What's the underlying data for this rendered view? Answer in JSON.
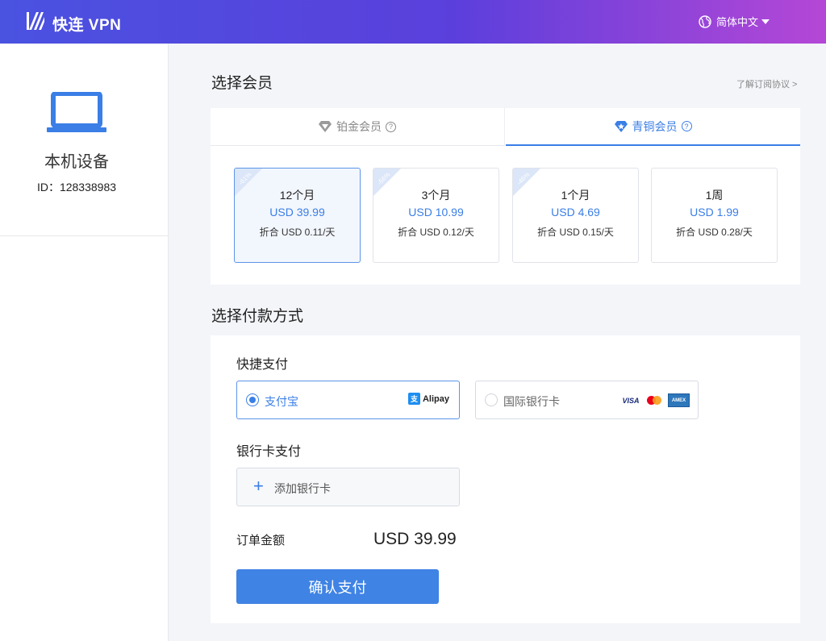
{
  "header": {
    "app_title": "快连 VPN",
    "language": "简体中文",
    "logo_icon": "brand-logo-icon",
    "globe_icon": "globe-icon"
  },
  "sidebar": {
    "device_icon": "laptop-icon",
    "device_title": "本机设备",
    "device_id": "ID：128338983"
  },
  "membership": {
    "section_title": "选择会员",
    "agreement_link": "了解订阅协议 >",
    "tabs": [
      {
        "label": "铂金会员",
        "icon": "diamond-icon",
        "active": false
      },
      {
        "label": "青铜会员",
        "icon": "diamond-star-icon",
        "active": true
      }
    ],
    "plans": [
      {
        "discount": "-61%",
        "duration": "12个月",
        "price": "USD 39.99",
        "per_day": "折合 USD 0.11/天",
        "selected": true
      },
      {
        "discount": "-56%",
        "duration": "3个月",
        "price": "USD 10.99",
        "per_day": "折合 USD 0.12/天",
        "selected": false
      },
      {
        "discount": "-46%",
        "duration": "1个月",
        "price": "USD 4.69",
        "per_day": "折合 USD 0.15/天",
        "selected": false
      },
      {
        "discount": "",
        "duration": "1周",
        "price": "USD 1.99",
        "per_day": "折合 USD 0.28/天",
        "selected": false
      }
    ]
  },
  "payment": {
    "section_title": "选择付款方式",
    "quick_pay_title": "快捷支付",
    "options": [
      {
        "label": "支付宝",
        "brand": "Alipay",
        "brand_badge": "支",
        "selected": true
      },
      {
        "label": "国际银行卡",
        "brands": [
          "VISA",
          "MasterCard",
          "AMEX"
        ],
        "selected": false
      }
    ],
    "bank_card_title": "银行卡支付",
    "add_card_label": "添加银行卡",
    "order_label": "订单金额",
    "order_amount": "USD 39.99",
    "confirm_label": "确认支付"
  },
  "colors": {
    "accent": "#3a7ee6",
    "header_gradient_start": "#4a52e0",
    "header_gradient_end": "#b547d6"
  }
}
